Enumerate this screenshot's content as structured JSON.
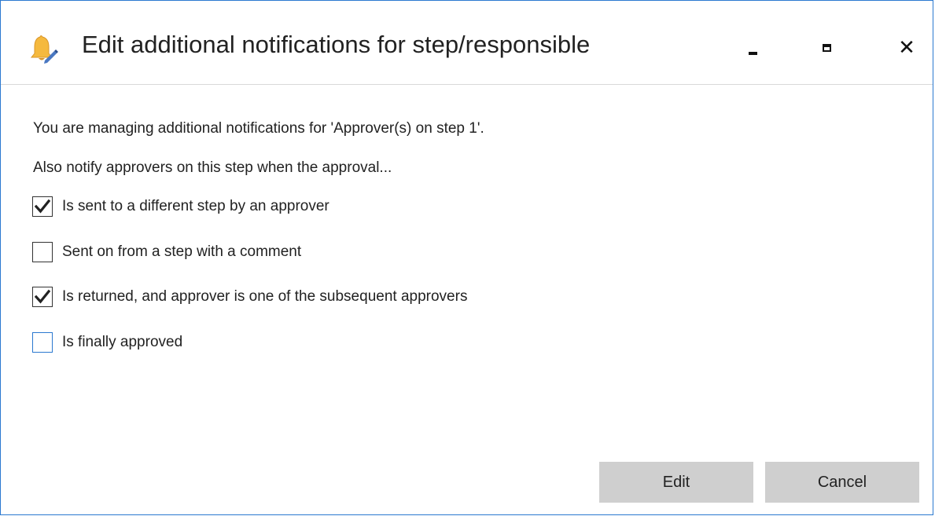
{
  "window": {
    "title": "Edit additional notifications for step/responsible",
    "icon": "bell-edit-icon",
    "controls": {
      "minimize": "minimize-icon",
      "maximize": "maximize-icon",
      "close": "close-icon"
    }
  },
  "content": {
    "intro": "You are managing additional notifications for 'Approver(s) on step 1'.",
    "instruction": "Also notify approvers on this step when the approval...",
    "options": [
      {
        "label": "Is sent to a different step by an approver",
        "checked": true
      },
      {
        "label": "Sent on from a step with a comment",
        "checked": false
      },
      {
        "label": "Is returned, and approver is one of the subsequent approvers",
        "checked": true
      },
      {
        "label": "Is finally approved",
        "checked": false
      }
    ]
  },
  "buttons": {
    "edit": "Edit",
    "cancel": "Cancel"
  },
  "colors": {
    "accent": "#2b79d0",
    "button_bg": "#cfcfcf",
    "bell": "#f5b93e"
  }
}
